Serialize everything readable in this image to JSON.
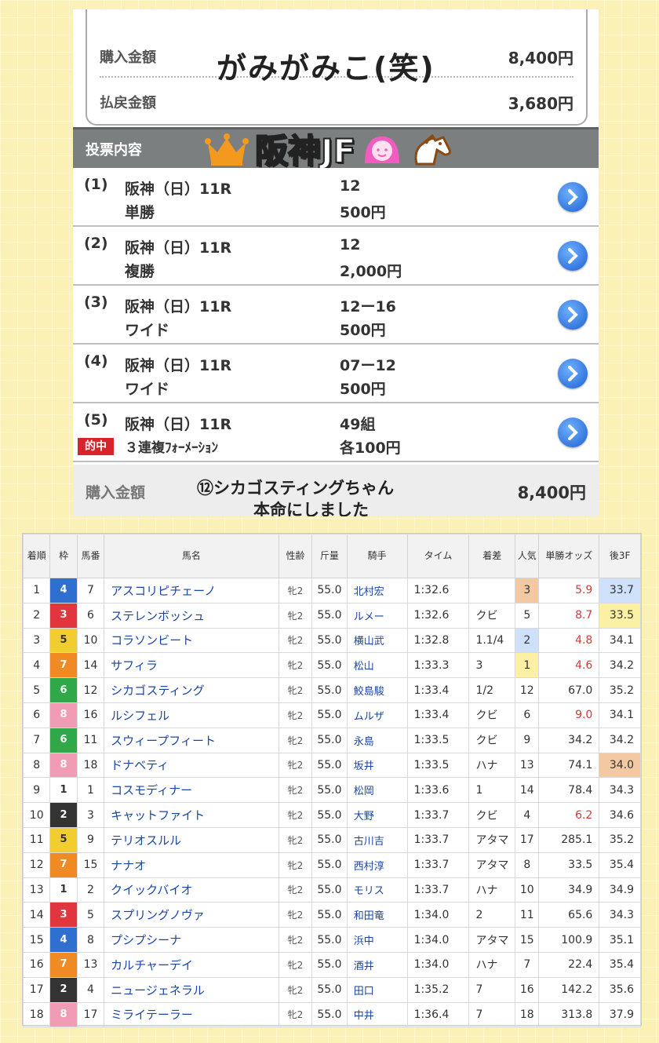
{
  "summary": {
    "purchase_label": "購入金額",
    "purchase_value": "8,400円",
    "payout_label": "払戻金額",
    "payout_value": "3,680円",
    "overlay_note": "がみがみこ(笑)"
  },
  "section": {
    "header": "投票内容",
    "race_title": "阪神JF"
  },
  "bets": [
    {
      "num": "(1)",
      "race": "阪神（日）11R",
      "type": "単勝",
      "selection": "12",
      "amount": "500円",
      "hit": ""
    },
    {
      "num": "(2)",
      "race": "阪神（日）11R",
      "type": "複勝",
      "selection": "12",
      "amount": "2,000円",
      "hit": ""
    },
    {
      "num": "(3)",
      "race": "阪神（日）11R",
      "type": "ワイド",
      "selection": "12ー16",
      "amount": "500円",
      "hit": ""
    },
    {
      "num": "(4)",
      "race": "阪神（日）11R",
      "type": "ワイド",
      "selection": "07ー12",
      "amount": "500円",
      "hit": ""
    },
    {
      "num": "(5)",
      "race": "阪神（日）11R",
      "type": "３連複ﾌｫｰﾒｰｼｮﾝ",
      "selection": "49組",
      "amount": "各100円",
      "hit": "的中"
    }
  ],
  "footer": {
    "label": "購入金額",
    "value": "8,400円",
    "note_line1": "⑫シカゴスティングちゃん",
    "note_line2": "本命にしました"
  },
  "colors": {
    "hit_badge": "#d6242a",
    "link_blue": "#1a45a8",
    "odds_red": "#d23a3a",
    "pop_highlight_blue": "#cfe0fb",
    "pop_highlight_orange": "#f3c9a4",
    "pop_highlight_yellow": "#fbf0a3"
  },
  "results": {
    "headers": [
      "着順",
      "枠",
      "馬番",
      "馬名",
      "性齢",
      "斤量",
      "騎手",
      "タイム",
      "着差",
      "人気",
      "単勝オッズ",
      "後3F"
    ],
    "rows": [
      {
        "pos": "1",
        "waku": "4",
        "num": "7",
        "name": "アスコリピチェーノ",
        "sexage": "牝2",
        "weight": "55.0",
        "jockey": "北村宏",
        "time": "1:32.6",
        "margin": "",
        "pop": "3",
        "odds": "5.9",
        "last3f": "33.7"
      },
      {
        "pos": "2",
        "waku": "3",
        "num": "6",
        "name": "ステレンボッシュ",
        "sexage": "牝2",
        "weight": "55.0",
        "jockey": "ルメー",
        "time": "1:32.6",
        "margin": "クビ",
        "pop": "5",
        "odds": "8.7",
        "last3f": "33.5"
      },
      {
        "pos": "3",
        "waku": "5",
        "num": "10",
        "name": "コラソンビート",
        "sexage": "牝2",
        "weight": "55.0",
        "jockey": "横山武",
        "time": "1:32.8",
        "margin": "1.1/4",
        "pop": "2",
        "odds": "4.8",
        "last3f": "34.1"
      },
      {
        "pos": "4",
        "waku": "7",
        "num": "14",
        "name": "サフィラ",
        "sexage": "牝2",
        "weight": "55.0",
        "jockey": "松山",
        "time": "1:33.3",
        "margin": "3",
        "pop": "1",
        "odds": "4.6",
        "last3f": "34.2"
      },
      {
        "pos": "5",
        "waku": "6",
        "num": "12",
        "name": "シカゴスティング",
        "sexage": "牝2",
        "weight": "55.0",
        "jockey": "鮫島駿",
        "time": "1:33.4",
        "margin": "1/2",
        "pop": "12",
        "odds": "67.0",
        "last3f": "35.2"
      },
      {
        "pos": "6",
        "waku": "8",
        "num": "16",
        "name": "ルシフェル",
        "sexage": "牝2",
        "weight": "55.0",
        "jockey": "ムルザ",
        "time": "1:33.4",
        "margin": "クビ",
        "pop": "6",
        "odds": "9.0",
        "last3f": "34.1"
      },
      {
        "pos": "7",
        "waku": "6",
        "num": "11",
        "name": "スウィープフィート",
        "sexage": "牝2",
        "weight": "55.0",
        "jockey": "永島",
        "time": "1:33.5",
        "margin": "クビ",
        "pop": "9",
        "odds": "34.2",
        "last3f": "34.2"
      },
      {
        "pos": "8",
        "waku": "8",
        "num": "18",
        "name": "ドナベティ",
        "sexage": "牝2",
        "weight": "55.0",
        "jockey": "坂井",
        "time": "1:33.5",
        "margin": "ハナ",
        "pop": "13",
        "odds": "74.1",
        "last3f": "34.0"
      },
      {
        "pos": "9",
        "waku": "1",
        "num": "1",
        "name": "コスモディナー",
        "sexage": "牝2",
        "weight": "55.0",
        "jockey": "松岡",
        "time": "1:33.6",
        "margin": "1",
        "pop": "14",
        "odds": "78.4",
        "last3f": "34.3"
      },
      {
        "pos": "10",
        "waku": "2",
        "num": "3",
        "name": "キャットファイト",
        "sexage": "牝2",
        "weight": "55.0",
        "jockey": "大野",
        "time": "1:33.7",
        "margin": "クビ",
        "pop": "4",
        "odds": "6.2",
        "last3f": "34.6"
      },
      {
        "pos": "11",
        "waku": "5",
        "num": "9",
        "name": "テリオスルル",
        "sexage": "牝2",
        "weight": "55.0",
        "jockey": "古川吉",
        "time": "1:33.7",
        "margin": "アタマ",
        "pop": "17",
        "odds": "285.1",
        "last3f": "35.2"
      },
      {
        "pos": "12",
        "waku": "7",
        "num": "15",
        "name": "ナナオ",
        "sexage": "牝2",
        "weight": "55.0",
        "jockey": "西村淳",
        "time": "1:33.7",
        "margin": "アタマ",
        "pop": "8",
        "odds": "33.5",
        "last3f": "35.4"
      },
      {
        "pos": "13",
        "waku": "1",
        "num": "2",
        "name": "クイックバイオ",
        "sexage": "牝2",
        "weight": "55.0",
        "jockey": "モリス",
        "time": "1:33.7",
        "margin": "ハナ",
        "pop": "10",
        "odds": "34.9",
        "last3f": "34.9"
      },
      {
        "pos": "14",
        "waku": "3",
        "num": "5",
        "name": "スプリングノヴァ",
        "sexage": "牝2",
        "weight": "55.0",
        "jockey": "和田竜",
        "time": "1:34.0",
        "margin": "2",
        "pop": "11",
        "odds": "65.6",
        "last3f": "34.3"
      },
      {
        "pos": "15",
        "waku": "4",
        "num": "8",
        "name": "プシプシーナ",
        "sexage": "牝2",
        "weight": "55.0",
        "jockey": "浜中",
        "time": "1:34.0",
        "margin": "アタマ",
        "pop": "15",
        "odds": "100.9",
        "last3f": "35.1"
      },
      {
        "pos": "16",
        "waku": "7",
        "num": "13",
        "name": "カルチャーデイ",
        "sexage": "牝2",
        "weight": "55.0",
        "jockey": "酒井",
        "time": "1:34.0",
        "margin": "ハナ",
        "pop": "7",
        "odds": "22.4",
        "last3f": "35.4"
      },
      {
        "pos": "17",
        "waku": "2",
        "num": "4",
        "name": "ニュージェネラル",
        "sexage": "牝2",
        "weight": "55.0",
        "jockey": "田口",
        "time": "1:35.2",
        "margin": "7",
        "pop": "16",
        "odds": "142.2",
        "last3f": "35.6"
      },
      {
        "pos": "18",
        "waku": "8",
        "num": "17",
        "name": "ミライテーラー",
        "sexage": "牝2",
        "weight": "55.0",
        "jockey": "中井",
        "time": "1:36.4",
        "margin": "7",
        "pop": "18",
        "odds": "313.8",
        "last3f": "37.9"
      }
    ]
  }
}
